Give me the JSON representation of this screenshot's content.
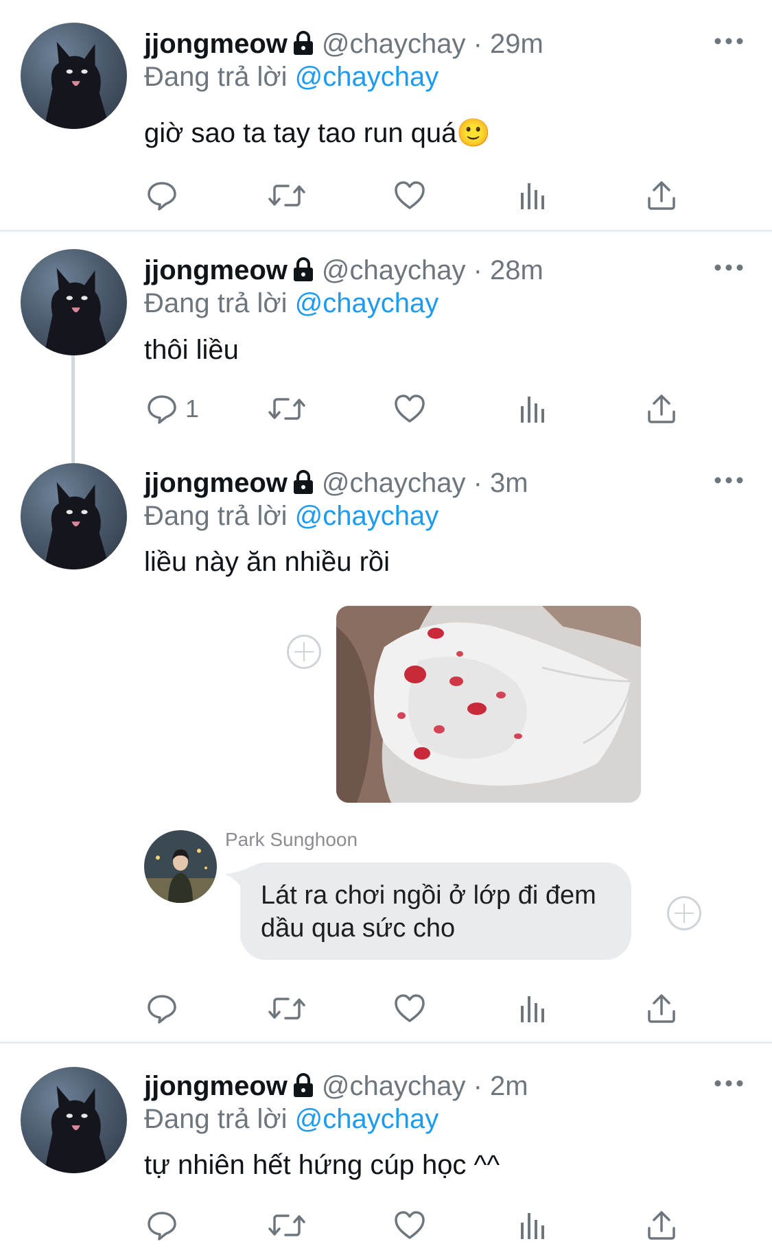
{
  "tweets": [
    {
      "name": "jjongmeow",
      "handle": "@chaychay · 29m",
      "reply_prefix": "Đang trả lời",
      "reply_mention": "@chaychay",
      "text": "giờ sao ta tay tao run quá🙂",
      "reply_count": ""
    },
    {
      "name": "jjongmeow",
      "handle": "@chaychay · 28m",
      "reply_prefix": "Đang trả lời",
      "reply_mention": "@chaychay",
      "text": "thôi liều",
      "reply_count": "1"
    },
    {
      "name": "jjongmeow",
      "handle": "@chaychay · 3m",
      "reply_prefix": "Đang trả lời",
      "reply_mention": "@chaychay",
      "text": "liều này ăn nhiều rồi",
      "reply_count": ""
    },
    {
      "name": "jjongmeow",
      "handle": "@chaychay · 2m",
      "reply_prefix": "Đang trả lời",
      "reply_mention": "@chaychay",
      "text": "tự nhiên hết hứng cúp học ^^",
      "reply_count": ""
    }
  ],
  "embedded_chat": {
    "sender": "Park Sunghoon",
    "message_line1": "Lát ra chơi ngồi ở lớp đi đem",
    "message_line2": "dầu qua sức cho"
  },
  "icons": [
    "lock-icon",
    "more-icon",
    "reply-icon",
    "retweet-icon",
    "like-icon",
    "analytics-icon",
    "share-icon",
    "add-reaction-icon"
  ],
  "colors": {
    "mention": "#1d9bf0",
    "secondary_text": "#6e767d",
    "divider": "#e6ecf0",
    "chat_bubble": "#e9ebee"
  }
}
